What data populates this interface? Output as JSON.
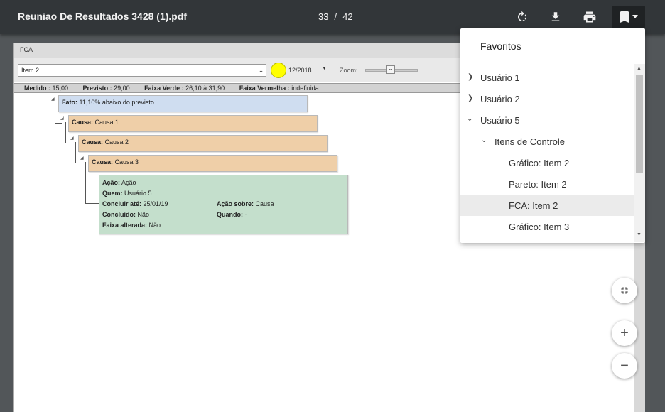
{
  "toolbar": {
    "title": "Reuniao De Resultados 3428 (1).pdf",
    "page_current": "33",
    "page_sep": "/",
    "page_total": "42"
  },
  "report": {
    "header": "FCA",
    "select_value": "Item 2",
    "date": "12/2018",
    "zoom_label": "Zoom:",
    "status": {
      "medido_label": "Medido :",
      "medido_value": " 15,00",
      "previsto_label": "Previsto :",
      "previsto_value": " 29,00",
      "verde_label": "Faixa Verde :",
      "verde_value": " 26,10 à 31,90",
      "vermelha_label": "Faixa Vermelha :",
      "vermelha_value": " indefinida"
    },
    "fato": {
      "label": "Fato:",
      "text": " 11,10% abaixo do previsto."
    },
    "causas": [
      {
        "label": "Causa:",
        "text": " Causa 1"
      },
      {
        "label": "Causa:",
        "text": " Causa 2"
      },
      {
        "label": "Causa:",
        "text": " Causa 3"
      }
    ],
    "acao": {
      "acao_label": "Ação:",
      "acao_value": " Ação",
      "quem_label": "Quem:",
      "quem_value": " Usuário 5",
      "concluir_label": "Concluir até:",
      "concluir_value": " 25/01/19",
      "sobre_label": "Ação sobre:",
      "sobre_value": " Causa",
      "concluido_label": "Concluído:",
      "concluido_value": " Não",
      "quando_label": "Quando:",
      "quando_value": " -",
      "faixa_label": "Faixa alterada:",
      "faixa_value": " Não"
    }
  },
  "bookmarks": {
    "title": "Favoritos",
    "items": [
      {
        "label": "Usuário 1",
        "expanded": false,
        "level": 0
      },
      {
        "label": "Usuário 2",
        "expanded": false,
        "level": 0
      },
      {
        "label": "Usuário 5",
        "expanded": true,
        "level": 0
      },
      {
        "label": "Itens de Controle",
        "expanded": true,
        "level": 1
      },
      {
        "label": "Gráfico: Item 2",
        "level": 2
      },
      {
        "label": "Pareto: Item 2",
        "level": 2
      },
      {
        "label": "FCA: Item 2",
        "level": 2,
        "selected": true
      },
      {
        "label": "Gráfico: Item 3",
        "level": 2
      }
    ]
  },
  "colors": {
    "toolbar": "#323639",
    "fato": "#cfddf0",
    "causa": "#efcfa8",
    "acao": "#c4dfcc",
    "indicator": "#ffff00"
  },
  "icons": [
    "rotate-icon",
    "download-icon",
    "print-icon",
    "bookmark-icon",
    "fit-page-icon",
    "zoom-in-icon",
    "zoom-out-icon"
  ]
}
